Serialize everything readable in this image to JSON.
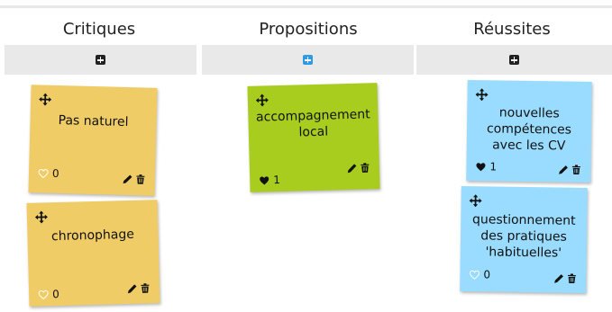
{
  "columns": [
    {
      "title": "Critiques",
      "add_button_color": "#222222",
      "notes": [
        {
          "text": "Pas naturel",
          "likes": "0",
          "liked": false,
          "color": "#f0cc66"
        },
        {
          "text": "chronophage",
          "likes": "0",
          "liked": false,
          "color": "#f0cc66"
        }
      ]
    },
    {
      "title": "Propositions",
      "add_button_color": "#2f9be3",
      "notes": [
        {
          "text": "accompagnement local",
          "likes": "1",
          "liked": true,
          "color": "#a8cd1e"
        }
      ]
    },
    {
      "title": "Réussites",
      "add_button_color": "#222222",
      "notes": [
        {
          "text": "nouvelles compétences avec les CV",
          "likes": "1",
          "liked": true,
          "color": "#99dcff"
        },
        {
          "text": "questionnement des pratiques 'habituelles'",
          "likes": "0",
          "liked": false,
          "color": "#99dcff"
        }
      ]
    }
  ],
  "icons": {
    "add": "plus-square-icon",
    "move": "move-arrows-icon",
    "like_empty": "heart-outline-icon",
    "like_full": "heart-filled-icon",
    "edit": "pencil-icon",
    "delete": "trash-icon"
  }
}
